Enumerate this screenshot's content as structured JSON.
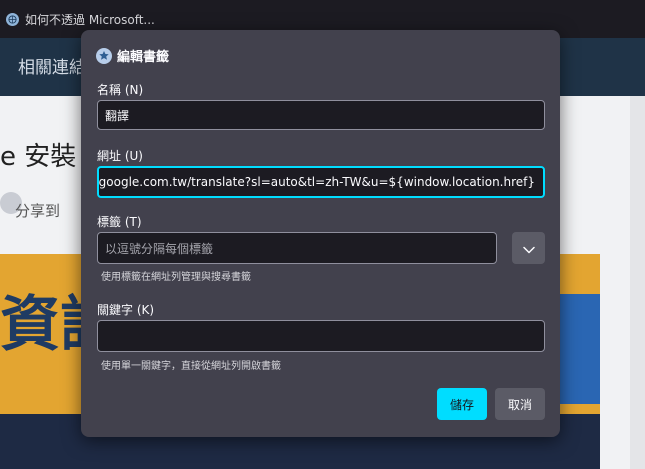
{
  "browser": {
    "tab_title": "如何不透過 Microsoft...",
    "site_nav_text": "相關連結",
    "article_title_fragment": "e 安裝",
    "share_text": "分享到",
    "banner_text": "資訊"
  },
  "dialog": {
    "title": "編輯書籤",
    "name": {
      "label": "名稱 (N)",
      "value": "翻譯"
    },
    "url": {
      "label": "網址 (U)",
      "value": "late.google.com.tw/translate?sl=auto&tl=zh-TW&u=${window.location.href}"
    },
    "tags": {
      "label": "標籤 (T)",
      "placeholder": "以逗號分隔每個標籤",
      "hint": "使用標籤在網址列管理與搜尋書籤"
    },
    "keyword": {
      "label": "關鍵字 (K)",
      "value": "",
      "hint": "使用單一關鍵字，直接從網址列開啟書籤"
    },
    "buttons": {
      "save": "儲存",
      "cancel": "取消"
    }
  },
  "colors": {
    "dialog_bg": "#42414d",
    "field_bg": "#1c1b22",
    "accent": "#00ddff",
    "secondary_button": "#5b5b66"
  },
  "icons": {
    "favicon": "globe-icon",
    "dialog": "bookmark-star-icon",
    "dropdown": "chevron-down-icon"
  }
}
